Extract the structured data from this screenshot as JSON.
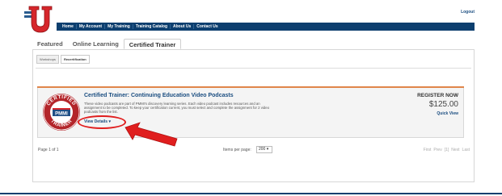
{
  "header": {
    "logout_label": "Logout",
    "nav": [
      "Home",
      "My Account",
      "My Training",
      "Training Catalog",
      "About Us",
      "Contact Us"
    ]
  },
  "tabs": [
    "Featured",
    "Online Learning",
    "Certified Trainer"
  ],
  "active_tab": "Certified Trainer",
  "subtabs": [
    "Workshops",
    "Recertification"
  ],
  "active_subtab": "Recertification",
  "course": {
    "title": "Certified Trainer: Continuing Education Video Podcasts",
    "description": "These video podcasts are part of PMMI's discovery learning series. Each video podcast includes resources and an assignment to be completed. To keep your certification current, you must select and complete the assignment for 2 video podcasts from the list.",
    "view_details_label": "View Details ▾",
    "register_label": "REGISTER NOW",
    "price": "$125.00",
    "quick_view_label": "Quick View",
    "seal": {
      "top_text": "CERTIFIED",
      "center_text": "PMMI",
      "bottom_text": "TRAINER"
    }
  },
  "pagination": {
    "page_label": "Page 1 of 1",
    "items_per_page_label": "Items per page:",
    "items_per_page_value": "200 ▾",
    "first_label": "First",
    "prev_label": "Prev",
    "current_label": "[1]",
    "next_label": "Next",
    "last_label": "Last"
  },
  "colors": {
    "nav_bg": "#0d3f6f",
    "link": "#1a4d80",
    "accent_orange": "#e0864a",
    "annotation_red": "#e01e1e"
  }
}
